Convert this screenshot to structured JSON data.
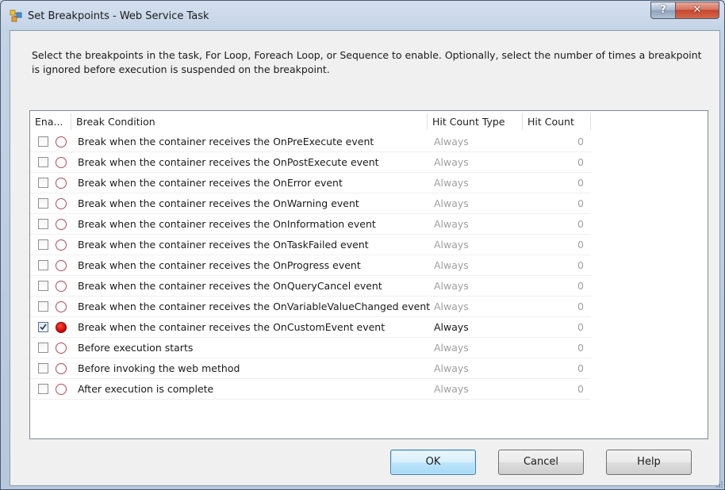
{
  "window": {
    "title": "Set Breakpoints - Web Service Task",
    "help_glyph": "?",
    "close_glyph": "✕"
  },
  "description": "Select the breakpoints in the task, For Loop, Foreach Loop, or Sequence to enable. Optionally, select the number of times a breakpoint is ignored before execution is suspended on the breakpoint.",
  "grid": {
    "columns": [
      "Ena...",
      "Break Condition",
      "Hit Count Type",
      "Hit Count"
    ],
    "rows": [
      {
        "enabled": false,
        "condition": "Break when the container receives the OnPreExecute event",
        "hit_count_type": "Always",
        "hit_count": "0"
      },
      {
        "enabled": false,
        "condition": "Break when the container receives the OnPostExecute event",
        "hit_count_type": "Always",
        "hit_count": "0"
      },
      {
        "enabled": false,
        "condition": "Break when the container receives the OnError event",
        "hit_count_type": "Always",
        "hit_count": "0"
      },
      {
        "enabled": false,
        "condition": "Break when the container receives the OnWarning event",
        "hit_count_type": "Always",
        "hit_count": "0"
      },
      {
        "enabled": false,
        "condition": "Break when the container receives the OnInformation event",
        "hit_count_type": "Always",
        "hit_count": "0"
      },
      {
        "enabled": false,
        "condition": "Break when the container receives the OnTaskFailed event",
        "hit_count_type": "Always",
        "hit_count": "0"
      },
      {
        "enabled": false,
        "condition": "Break when the container receives the OnProgress event",
        "hit_count_type": "Always",
        "hit_count": "0"
      },
      {
        "enabled": false,
        "condition": "Break when the container receives the OnQueryCancel event",
        "hit_count_type": "Always",
        "hit_count": "0"
      },
      {
        "enabled": false,
        "condition": "Break when the container receives the OnVariableValueChanged event",
        "hit_count_type": "Always",
        "hit_count": "0"
      },
      {
        "enabled": true,
        "condition": "Break when the container receives the OnCustomEvent event",
        "hit_count_type": "Always",
        "hit_count": "0"
      },
      {
        "enabled": false,
        "condition": "Before execution starts",
        "hit_count_type": "Always",
        "hit_count": "0"
      },
      {
        "enabled": false,
        "condition": "Before invoking the web method",
        "hit_count_type": "Always",
        "hit_count": "0"
      },
      {
        "enabled": false,
        "condition": "After execution is complete",
        "hit_count_type": "Always",
        "hit_count": "0"
      }
    ]
  },
  "buttons": {
    "ok": "OK",
    "cancel": "Cancel",
    "help": "Help"
  },
  "colors": {
    "breakpoint_active": "#d10a0a",
    "breakpoint_inactive_ring": "#b04a5a",
    "default_button_border": "#3c7fb1"
  }
}
